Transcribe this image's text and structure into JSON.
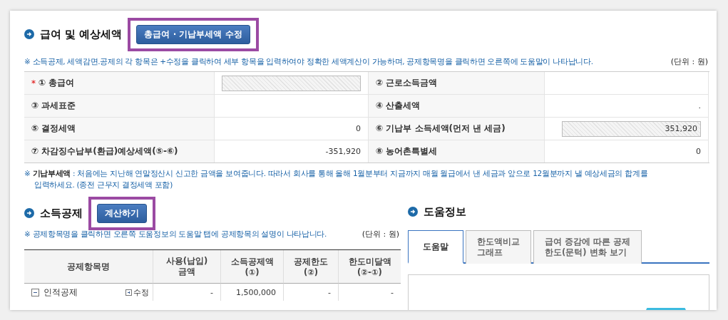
{
  "salary_section": {
    "title": "급여 및 예상세액",
    "edit_button": "총급여 · 기납부세액 수정",
    "notice": "※ 소득공제, 세액감면.공제의 각 항목은 +수정을 클릭하여 세부 항목을 입력하여야 정확한 세액계산이 가능하며, 공제항목명을 클릭하면 오른쪽에 도움말이 나타납니다.",
    "unit": "(단위 : 원)",
    "rows": [
      [
        {
          "marker": "*",
          "label": "① 총급여",
          "kind": "input"
        },
        {
          "label": "② 근로소득금액",
          "kind": "text"
        }
      ],
      [
        {
          "label": "③ 과세표준",
          "kind": "text"
        },
        {
          "label": "④ 산출세액",
          "kind": "text",
          "value": "."
        }
      ],
      [
        {
          "label": "⑤ 결정세액",
          "kind": "text",
          "value": "0"
        },
        {
          "label": "⑥ 기납부 소득세액(먼저 낸 세금)",
          "kind": "input",
          "value": "351,920"
        }
      ],
      [
        {
          "label": "⑦ 차감징수납부(환급)예상세액(⑤-⑥)",
          "kind": "text",
          "value": "-351,920"
        },
        {
          "label": "⑧ 농어촌특별세",
          "kind": "text",
          "value": "0"
        }
      ]
    ],
    "footnote": "※ **기납부세액** : 처음에는 지난해 연말정산시 신고한 금액을 보여줍니다. 따라서 회사를 통해 올해 1월분부터 지금까지 매월 월급에서 낸 세금과 앞으로 12월분까지 낼 예상세금의 합계를 입력하세요. (종전 근무지 결정세액 포함)"
  },
  "deduction_section": {
    "title": "소득공제",
    "calc_button": "계산하기",
    "notice": "※ 공제항목명을 클릭하면 오른쪽 도움정보의 도움말 탭에 공제항목의 설명이 나타납니다.",
    "unit": "(단위 : 원)",
    "name_column": "공제항목명",
    "columns": [
      "사용(납입)\n금액",
      "소득공제액\n(①)",
      "공제한도\n(②)",
      "한도미달액\n(②-①)"
    ],
    "rows": [
      {
        "name": "인적공제",
        "expanded": true,
        "edit": "수정",
        "cells": [
          "-",
          "1,500,000",
          "-",
          "-"
        ]
      }
    ]
  },
  "help_section": {
    "title": "도움정보",
    "tabs": [
      {
        "label": "도움말",
        "selected": true
      },
      {
        "label": "한도액비교\n그래프",
        "selected": false
      },
      {
        "label": "급여 증감에 따른 공제\n한도(문턱) 변화 보기",
        "selected": false
      }
    ]
  }
}
